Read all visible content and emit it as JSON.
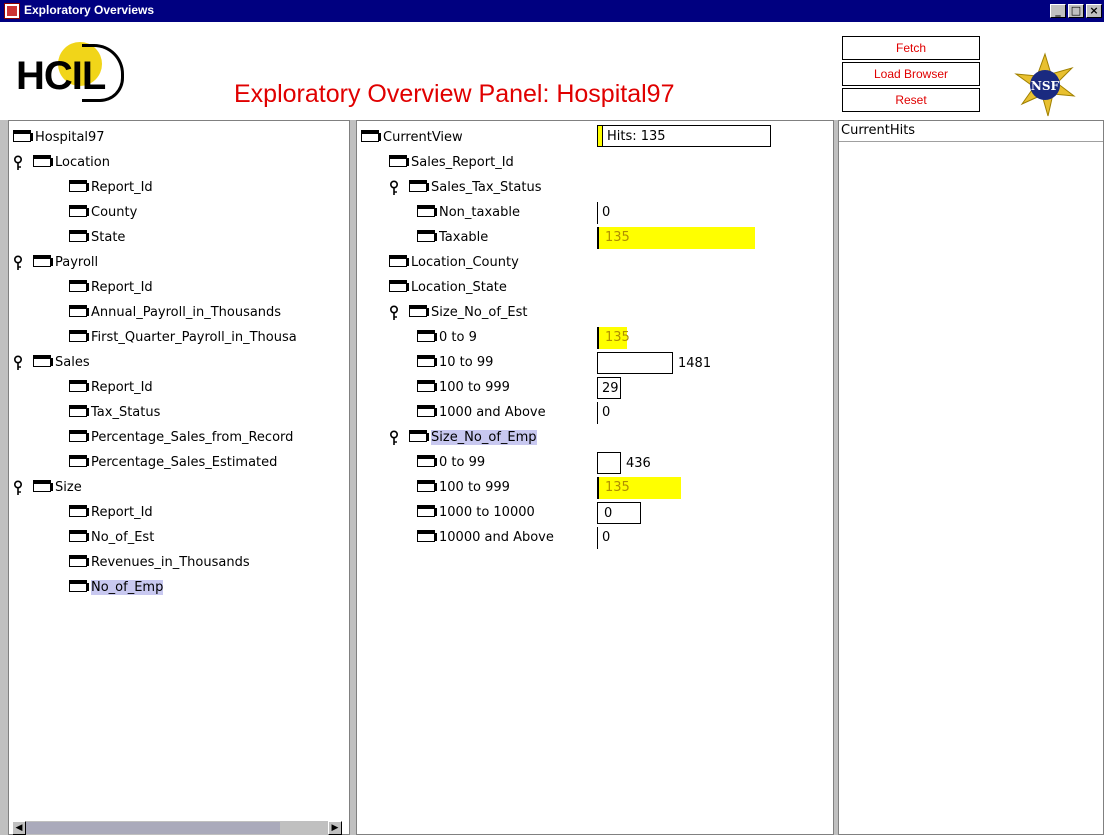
{
  "window": {
    "title": "Exploratory Overviews"
  },
  "header": {
    "title": "Exploratory Overview Panel: Hospital97",
    "logo_text": "HCIL",
    "buttons": {
      "fetch": "Fetch",
      "load_browser": "Load Browser",
      "reset": "Reset"
    },
    "title_color": "#e00000"
  },
  "left_tree": [
    {
      "label": "Hospital97",
      "has_key": false
    },
    {
      "label": "Location",
      "has_key": true
    },
    {
      "label": "Report_Id",
      "has_key": false
    },
    {
      "label": "County",
      "has_key": false
    },
    {
      "label": "State",
      "has_key": false
    },
    {
      "label": "Payroll",
      "has_key": true
    },
    {
      "label": "Report_Id",
      "has_key": false
    },
    {
      "label": "Annual_Payroll_in_Thousands",
      "has_key": false
    },
    {
      "label": "First_Quarter_Payroll_in_Thousa",
      "has_key": false
    },
    {
      "label": "Sales",
      "has_key": true
    },
    {
      "label": "Report_Id",
      "has_key": false
    },
    {
      "label": "Tax_Status",
      "has_key": false
    },
    {
      "label": "Percentage_Sales_from_Record",
      "has_key": false
    },
    {
      "label": "Percentage_Sales_Estimated",
      "has_key": false
    },
    {
      "label": "Size",
      "has_key": true
    },
    {
      "label": "Report_Id",
      "has_key": false
    },
    {
      "label": "No_of_Est",
      "has_key": false
    },
    {
      "label": "Revenues_in_Thousands",
      "has_key": false
    },
    {
      "label": "No_of_Emp",
      "has_key": false,
      "selected": true
    }
  ],
  "middle_tree": [
    {
      "label": "CurrentView",
      "has_key": false
    },
    {
      "label": "Sales_Report_Id",
      "has_key": false
    },
    {
      "label": "Sales_Tax_Status",
      "has_key": true
    },
    {
      "label": "Non_taxable",
      "has_key": false,
      "value": "0"
    },
    {
      "label": "Taxable",
      "has_key": false,
      "value": "135"
    },
    {
      "label": "Location_County",
      "has_key": false
    },
    {
      "label": "Location_State",
      "has_key": false
    },
    {
      "label": "Size_No_of_Est",
      "has_key": true
    },
    {
      "label": "0 to 9",
      "has_key": false,
      "value": "135"
    },
    {
      "label": "10 to 99",
      "has_key": false,
      "value": "1481"
    },
    {
      "label": "100 to 999",
      "has_key": false,
      "value": "29"
    },
    {
      "label": "1000 and Above",
      "has_key": false,
      "value": "0"
    },
    {
      "label": "Size_No_of_Emp",
      "has_key": true,
      "selected": true
    },
    {
      "label": "0 to 99",
      "has_key": false,
      "value": "436"
    },
    {
      "label": "100 to 999",
      "has_key": false,
      "value": "135"
    },
    {
      "label": "1000 to 10000",
      "has_key": false,
      "value": "0"
    },
    {
      "label": "10000 and Above",
      "has_key": false,
      "value": "0"
    }
  ],
  "hits": {
    "label": "Hits: 135"
  },
  "right_pane": {
    "title": "CurrentHits"
  },
  "colors": {
    "highlight": "#ffff00",
    "selection": "#c8c8f0"
  }
}
